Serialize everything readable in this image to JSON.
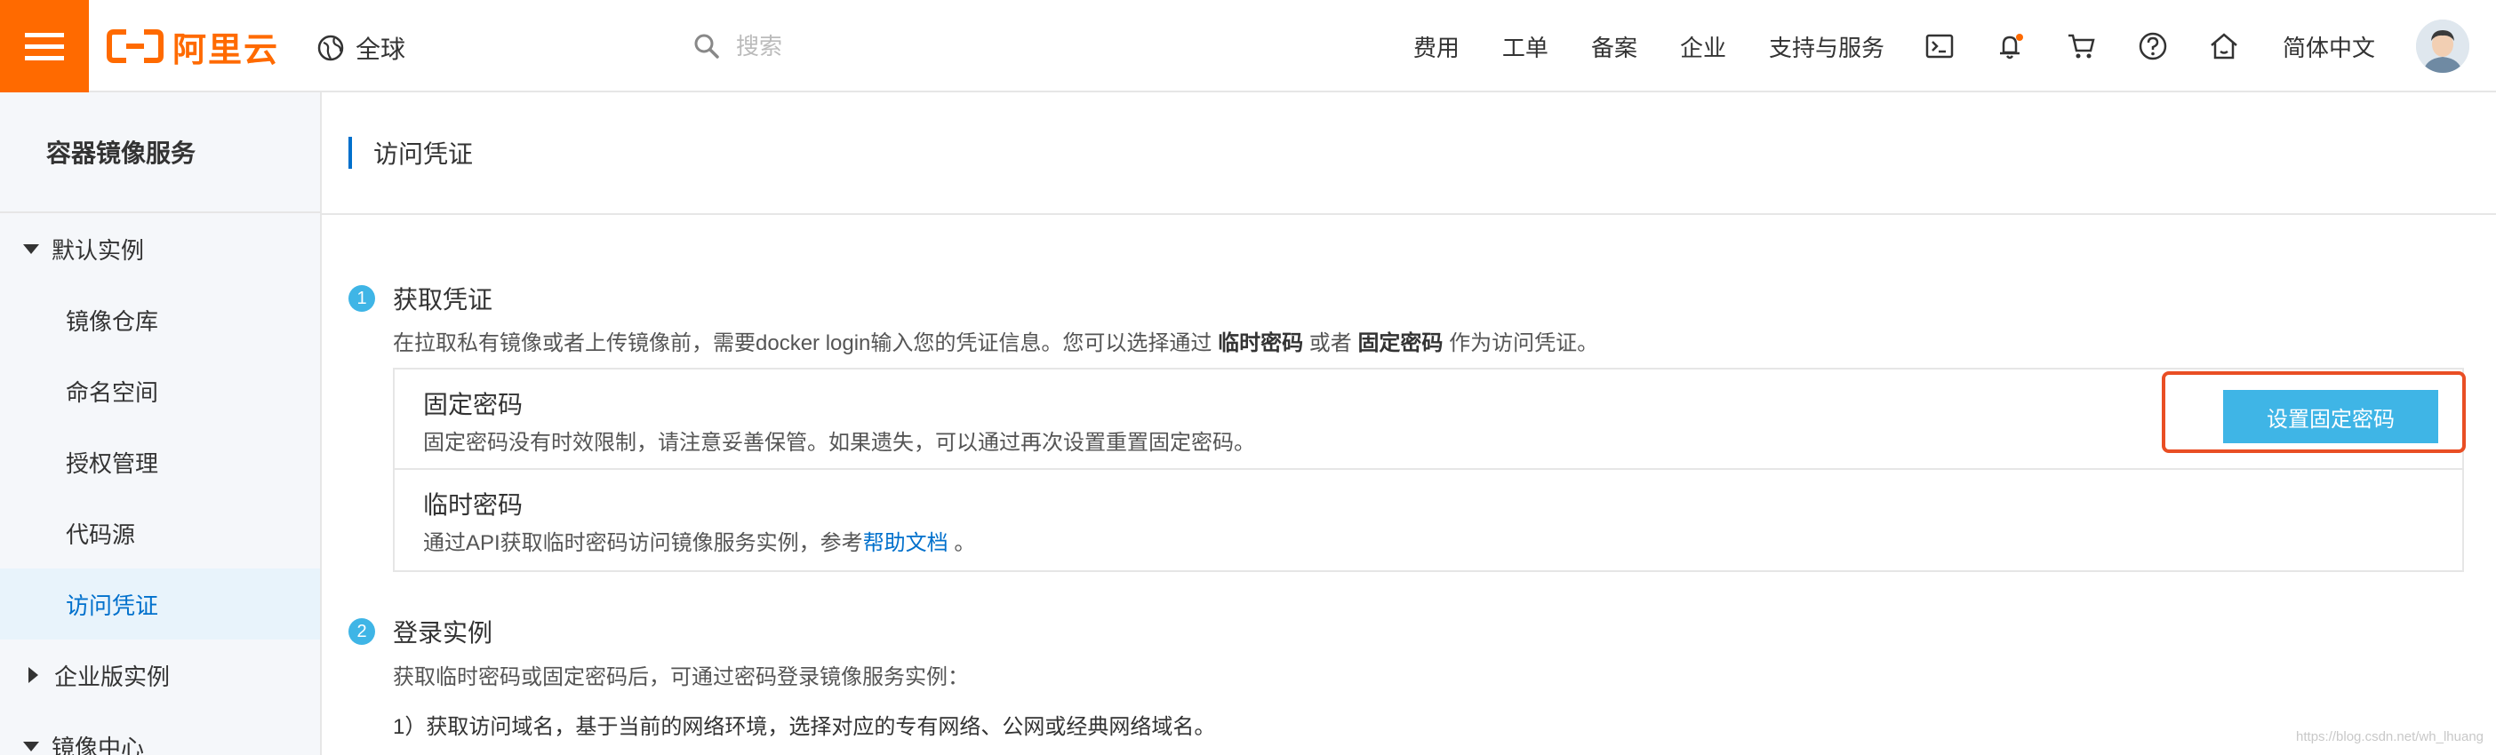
{
  "header": {
    "logo_text": "阿里云",
    "region": "全球",
    "search_placeholder": "搜索",
    "nav": [
      "费用",
      "工单",
      "备案",
      "企业",
      "支持与服务"
    ],
    "language": "简体中文",
    "icons": [
      "terminal-icon",
      "bell-icon",
      "cart-icon",
      "help-icon",
      "home-icon"
    ],
    "notification_dot_color": "#ff6a00"
  },
  "sidebar": {
    "title": "容器镜像服务",
    "group_default": "默认实例",
    "items": [
      "镜像仓库",
      "命名空间",
      "授权管理",
      "代码源",
      "访问凭证"
    ],
    "active_item": "访问凭证",
    "group_enterprise": "企业版实例",
    "group_mirror": "镜像中心"
  },
  "main": {
    "page_title": "访问凭证",
    "step1": {
      "num": "1",
      "title": "获取凭证",
      "desc_prefix": "在拉取私有镜像或者上传镜像前，需要docker login输入您的凭证信息。您可以选择通过",
      "desc_opt1": "临时密码",
      "desc_or": "或者",
      "desc_opt2": "固定密码",
      "desc_suffix": "作为访问凭证。"
    },
    "fixed": {
      "name": "固定密码",
      "desc": "固定密码没有时效限制，请注意妥善保管。如果遗失，可以通过再次设置重置固定密码。",
      "button": "设置固定密码"
    },
    "temp": {
      "name": "临时密码",
      "desc_prefix": "通过API获取临时密码访问镜像服务实例，参考",
      "link": "帮助文档",
      "desc_suffix": "。"
    },
    "step2": {
      "num": "2",
      "title": "登录实例",
      "desc": "获取临时密码或固定密码后，可通过密码登录镜像服务实例：",
      "item1": "1）获取访问域名，基于当前的网络环境，选择对应的专有网络、公网或经典网络域名。"
    }
  },
  "watermark": "https://blog.csdn.net/wh_lhuang",
  "colors": {
    "brand_orange": "#ff6a00",
    "primary_blue": "#3fb5e6",
    "link_blue": "#0070cc",
    "highlight_red": "#e94e24",
    "active_bg": "#e8f3fb"
  }
}
